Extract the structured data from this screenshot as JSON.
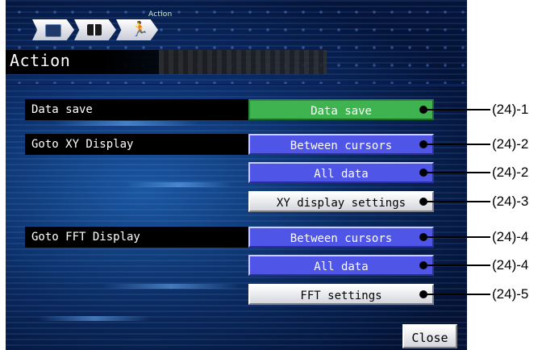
{
  "header": {
    "tab_action_label": "Action",
    "tabs": [
      {
        "icon": "waveform-screen-icon"
      },
      {
        "icon": "grid-layout-icon"
      },
      {
        "icon": "running-person-icon"
      }
    ]
  },
  "title": "Action",
  "rows": [
    {
      "label": "Data save",
      "button": "Data save",
      "style": "green",
      "callout": "(24)-1"
    },
    {
      "label": "Goto XY Display",
      "button": "Between cursors",
      "style": "blue",
      "callout": "(24)-2"
    },
    {
      "label": "",
      "button": "All data",
      "style": "blue",
      "callout": "(24)-2"
    },
    {
      "label": "",
      "button": "XY display settings",
      "style": "gray",
      "callout": "(24)-3"
    },
    {
      "label": "Goto FFT Display",
      "button": "Between cursors",
      "style": "blue",
      "callout": "(24)-4"
    },
    {
      "label": "",
      "button": "All data",
      "style": "blue",
      "callout": "(24)-4"
    },
    {
      "label": "",
      "button": "FFT settings",
      "style": "gray",
      "callout": "(24)-5"
    }
  ],
  "close_label": "Close",
  "colors": {
    "green": "#3fb34f",
    "blue": "#4f55e6",
    "background": "#0b2d6a"
  }
}
